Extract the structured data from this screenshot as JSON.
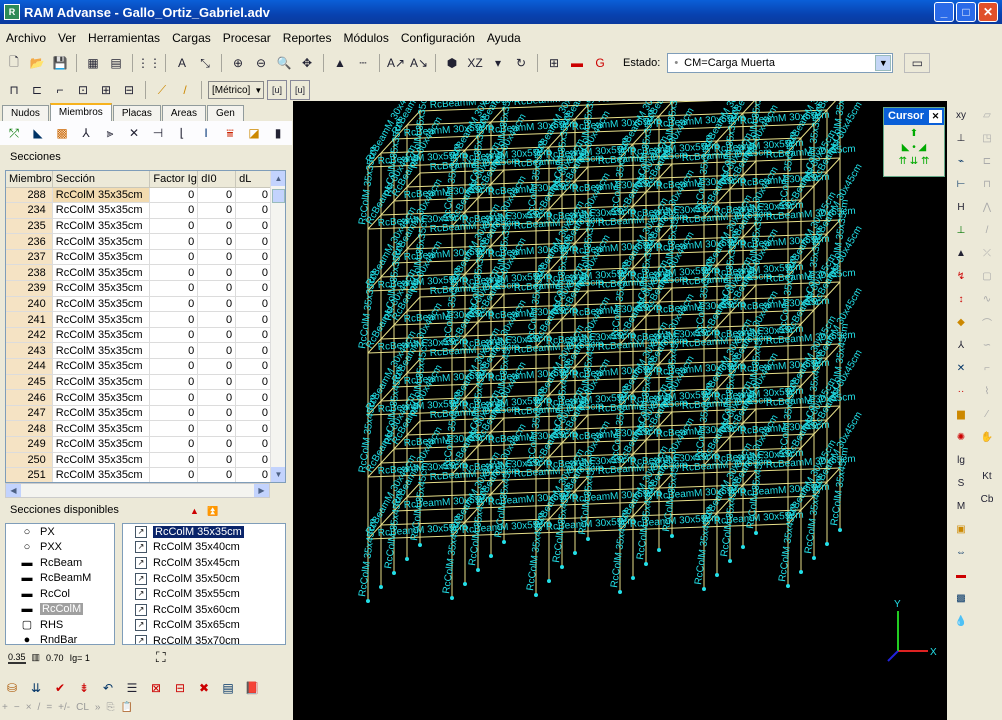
{
  "window": {
    "title": "RAM Advanse - Gallo_Ortiz_Gabriel.adv"
  },
  "menu": [
    "Archivo",
    "Ver",
    "Herramientas",
    "Cargas",
    "Procesar",
    "Reportes",
    "Módulos",
    "Configuración",
    "Ayuda"
  ],
  "toolbar": {
    "view_label": "XZ",
    "estado_label": "Estado:",
    "estado_value": "CM=Carga Muerta",
    "units_value": "[Métrico]",
    "unit_btn1": "[u]",
    "unit_btn2": "[u]"
  },
  "tabs": [
    {
      "label": "Nudos",
      "active": false
    },
    {
      "label": "Miembros",
      "active": true
    },
    {
      "label": "Placas",
      "active": false
    },
    {
      "label": "Areas",
      "active": false
    },
    {
      "label": "Gen",
      "active": false
    }
  ],
  "sections_label": "Secciones",
  "grid": {
    "headers": [
      "Miembro",
      "Sección",
      "Factor Ig",
      "dI0",
      "dL"
    ],
    "rows": [
      [
        "288",
        "RcColM 35x35cm",
        "0",
        "0",
        "0"
      ],
      [
        "234",
        "RcColM 35x35cm",
        "0",
        "0",
        "0"
      ],
      [
        "235",
        "RcColM 35x35cm",
        "0",
        "0",
        "0"
      ],
      [
        "236",
        "RcColM 35x35cm",
        "0",
        "0",
        "0"
      ],
      [
        "237",
        "RcColM 35x35cm",
        "0",
        "0",
        "0"
      ],
      [
        "238",
        "RcColM 35x35cm",
        "0",
        "0",
        "0"
      ],
      [
        "239",
        "RcColM 35x35cm",
        "0",
        "0",
        "0"
      ],
      [
        "240",
        "RcColM 35x35cm",
        "0",
        "0",
        "0"
      ],
      [
        "241",
        "RcColM 35x35cm",
        "0",
        "0",
        "0"
      ],
      [
        "242",
        "RcColM 35x35cm",
        "0",
        "0",
        "0"
      ],
      [
        "243",
        "RcColM 35x35cm",
        "0",
        "0",
        "0"
      ],
      [
        "244",
        "RcColM 35x35cm",
        "0",
        "0",
        "0"
      ],
      [
        "245",
        "RcColM 35x35cm",
        "0",
        "0",
        "0"
      ],
      [
        "246",
        "RcColM 35x35cm",
        "0",
        "0",
        "0"
      ],
      [
        "247",
        "RcColM 35x35cm",
        "0",
        "0",
        "0"
      ],
      [
        "248",
        "RcColM 35x35cm",
        "0",
        "0",
        "0"
      ],
      [
        "249",
        "RcColM 35x35cm",
        "0",
        "0",
        "0"
      ],
      [
        "250",
        "RcColM 35x35cm",
        "0",
        "0",
        "0"
      ],
      [
        "251",
        "RcColM 35x35cm",
        "0",
        "0",
        "0"
      ]
    ]
  },
  "available_label": "Secciones disponibles",
  "section_types": [
    {
      "label": "PX",
      "icon": "circle-icon"
    },
    {
      "label": "PXX",
      "icon": "circle-icon"
    },
    {
      "label": "RcBeam",
      "icon": "rect-icon"
    },
    {
      "label": "RcBeamM",
      "icon": "rect-icon"
    },
    {
      "label": "RcCol",
      "icon": "rect-icon"
    },
    {
      "label": "RcColM",
      "icon": "rect-icon",
      "selected": true
    },
    {
      "label": "RHS",
      "icon": "rhs-icon"
    },
    {
      "label": "RndBar",
      "icon": "dot-icon"
    }
  ],
  "section_list": [
    {
      "label": "RcColM 35x35cm",
      "selected": true
    },
    {
      "label": "RcColM 35x40cm"
    },
    {
      "label": "RcColM 35x45cm"
    },
    {
      "label": "RcColM 35x50cm"
    },
    {
      "label": "RcColM 35x55cm"
    },
    {
      "label": "RcColM 35x60cm"
    },
    {
      "label": "RcColM 35x65cm"
    },
    {
      "label": "RcColM 35x70cm"
    }
  ],
  "bottom": {
    "scale1": "0.35",
    "scale2": "0.70",
    "ig_label": "Ig= 1"
  },
  "cursor_panel": {
    "title": "Cursor"
  },
  "viewport": {
    "axes": {
      "x": "X",
      "y": "Y"
    },
    "labels": [
      "RcColM 35x45cm",
      "RcBeamM 30x55cm",
      "RcColM 35x35cm",
      "RcBeamM 30x45cm"
    ],
    "colors": {
      "background": "#000000",
      "frame": "#e8e08a",
      "labels": "#22e0e8"
    }
  },
  "rightbar": {
    "col1": [
      "xy",
      "S",
      "M"
    ],
    "col2": [
      "Kt",
      "Cb"
    ]
  }
}
